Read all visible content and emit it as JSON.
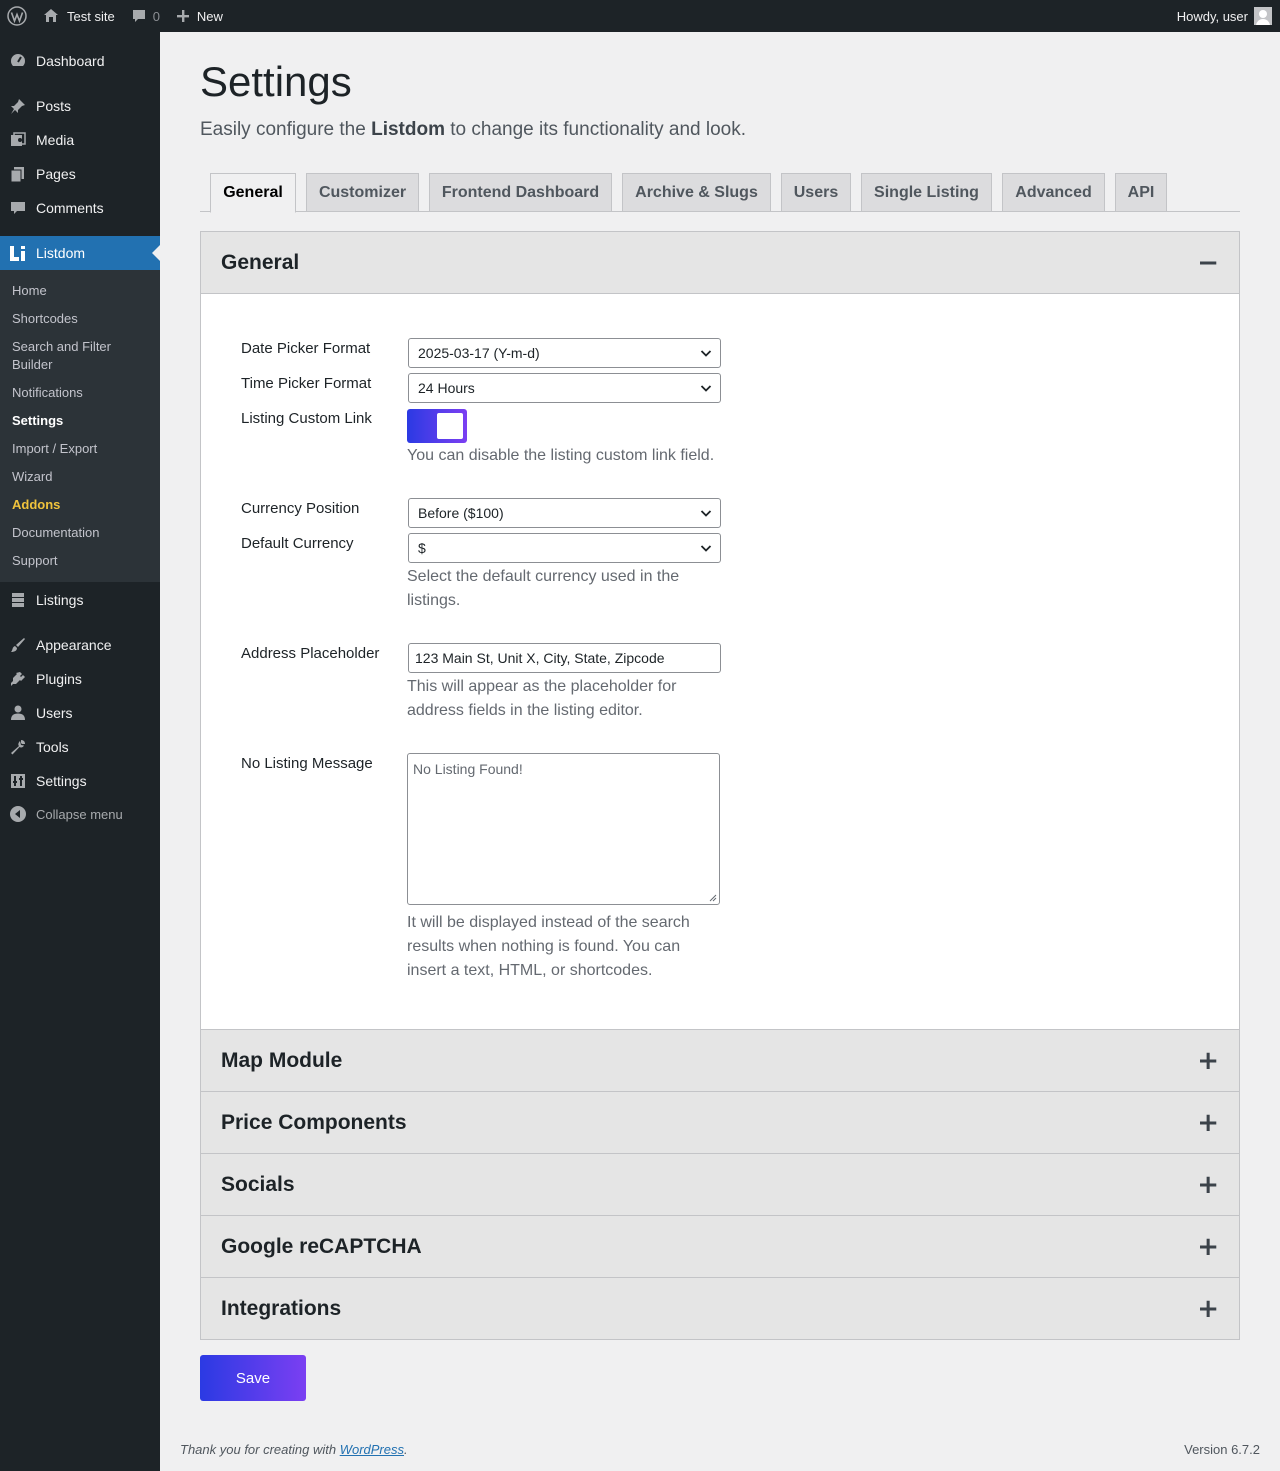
{
  "adminbar": {
    "site_name": "Test site",
    "comments_count": "0",
    "new_label": "New",
    "howdy": "Howdy, user"
  },
  "sidebar": {
    "top_items": [
      {
        "label": "Dashboard",
        "icon": "dashboard-icon"
      },
      {
        "label": "Posts",
        "icon": "pin-icon"
      },
      {
        "label": "Media",
        "icon": "media-icon"
      },
      {
        "label": "Pages",
        "icon": "pages-icon"
      },
      {
        "label": "Comments",
        "icon": "comment-icon"
      },
      {
        "label": "Listdom",
        "icon": "listdom-logo-icon"
      }
    ],
    "submenu": [
      "Home",
      "Shortcodes",
      "Search and Filter Builder",
      "Notifications",
      "Settings",
      "Import / Export",
      "Wizard",
      "Addons",
      "Documentation",
      "Support"
    ],
    "bottom_items": [
      {
        "label": "Listings",
        "icon": "listings-icon"
      },
      {
        "label": "Appearance",
        "icon": "brush-icon"
      },
      {
        "label": "Plugins",
        "icon": "plug-icon"
      },
      {
        "label": "Users",
        "icon": "user-icon"
      },
      {
        "label": "Tools",
        "icon": "wrench-icon"
      },
      {
        "label": "Settings",
        "icon": "settings-icon"
      }
    ],
    "collapse_label": "Collapse menu"
  },
  "page": {
    "title": "Settings",
    "subtitle_pre": "Easily configure the ",
    "subtitle_brand": "Listdom",
    "subtitle_post": " to change its functionality and look."
  },
  "tabs": [
    "General",
    "Customizer",
    "Frontend Dashboard",
    "Archive & Slugs",
    "Users",
    "Single Listing",
    "Advanced",
    "API"
  ],
  "general_panel": {
    "title": "General",
    "toggle": "−",
    "date_picker_label": "Date Picker Format",
    "date_picker_value": "2025-03-17 (Y-m-d)",
    "time_picker_label": "Time Picker Format",
    "time_picker_value": "24 Hours",
    "custom_link_label": "Listing Custom Link",
    "custom_link_enabled": true,
    "custom_link_desc": "You can disable the listing custom link field.",
    "currency_position_label": "Currency Position",
    "currency_position_value": "Before ($100)",
    "default_currency_label": "Default Currency",
    "default_currency_value": "$",
    "default_currency_desc": "Select the default currency used in the listings.",
    "address_placeholder_label": "Address Placeholder",
    "address_placeholder_value": "123 Main St, Unit X, City, State, Zipcode",
    "address_placeholder_desc": "This will appear as the placeholder for address fields in the listing editor.",
    "no_listing_label": "No Listing Message",
    "no_listing_value": "No Listing Found!",
    "no_listing_desc": "It will be displayed instead of the search results when nothing is found. You can insert a text, HTML, or shortcodes."
  },
  "collapsed_panels": [
    {
      "title": "Map Module",
      "toggle": "+"
    },
    {
      "title": "Price Components",
      "toggle": "+"
    },
    {
      "title": "Socials",
      "toggle": "+"
    },
    {
      "title": "Google reCAPTCHA",
      "toggle": "+"
    },
    {
      "title": "Integrations",
      "toggle": "+"
    }
  ],
  "save_label": "Save",
  "footer": {
    "thanks_pre": "Thank you for creating with ",
    "thanks_link": "WordPress",
    "thanks_post": ".",
    "version": "Version 6.7.2"
  },
  "colors": {
    "sidebar_bg": "#1d2327",
    "active_menu": "#2271b1",
    "gradient_start": "#2b3ae3",
    "gradient_end": "#7b3ff2",
    "addons": "#f0c33c"
  }
}
